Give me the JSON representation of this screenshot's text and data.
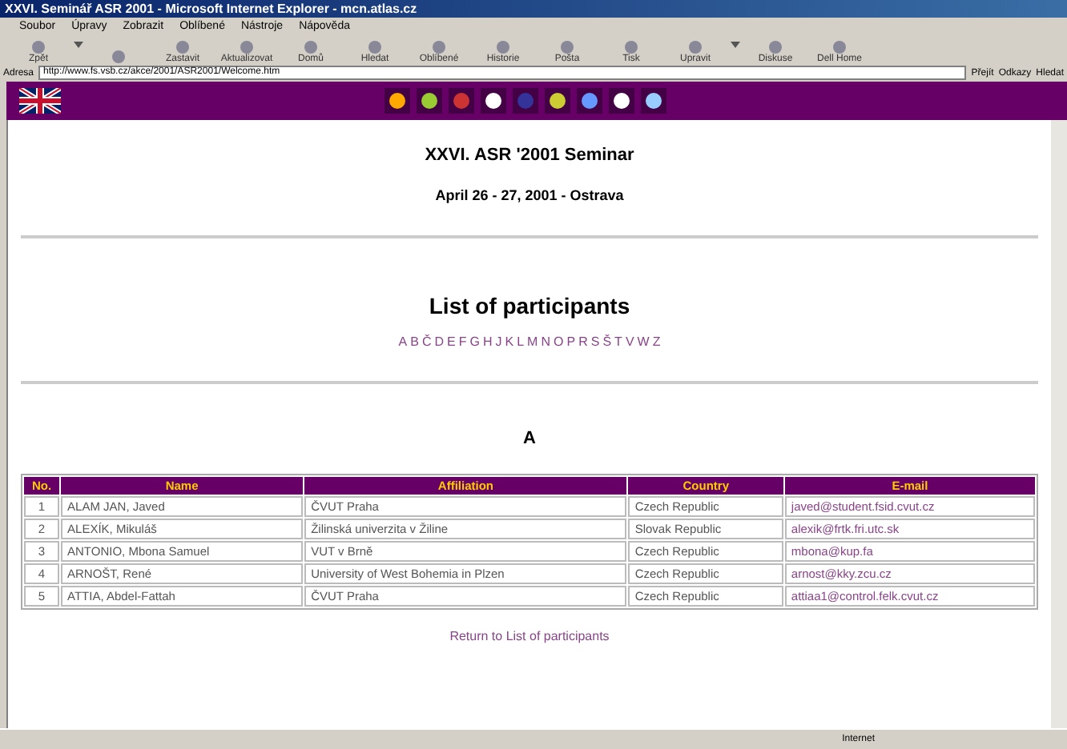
{
  "window": {
    "title": "XXVI. Seminář ASR 2001 - Microsoft Internet Explorer - mcn.atlas.cz"
  },
  "menu": [
    "Soubor",
    "Úpravy",
    "Zobrazit",
    "Oblíbené",
    "Nástroje",
    "Nápověda"
  ],
  "toolbar": [
    {
      "kind": "button",
      "label": "Zpět"
    },
    {
      "kind": "caret"
    },
    {
      "kind": "button"
    },
    {
      "kind": "button",
      "label": "Zastavit"
    },
    {
      "kind": "button",
      "label": "Aktualizovat"
    },
    {
      "kind": "button",
      "label": "Domů"
    },
    {
      "kind": "button",
      "label": "Hledat"
    },
    {
      "kind": "button",
      "label": "Oblíbené"
    },
    {
      "kind": "button",
      "label": "Historie"
    },
    {
      "kind": "button",
      "label": "Pošta"
    },
    {
      "kind": "button",
      "label": "Tisk"
    },
    {
      "kind": "button",
      "label": "Upravit"
    },
    {
      "kind": "caret"
    },
    {
      "kind": "button",
      "label": "Diskuse"
    },
    {
      "kind": "button",
      "label": "Dell Home"
    }
  ],
  "address": {
    "label": "Adresa",
    "url": "http://www.fs.vsb.cz/akce/2001/ASR2001/Welcome.htm",
    "go": "Přejít",
    "links": "Odkazy",
    "search": "Hledat"
  },
  "page": {
    "title": "XXVI. ASR '2001 Seminar",
    "date": "April 26 - 27, 2001 - Ostrava",
    "heading": "List of participants",
    "letters": [
      "A",
      "B",
      "Č",
      "D",
      "E",
      "F",
      "G",
      "H",
      "J",
      "K",
      "L",
      "M",
      "N",
      "O",
      "P",
      "R",
      "S",
      "Š",
      "T",
      "V",
      "W",
      "Z"
    ],
    "section": "A",
    "table": {
      "columns": [
        "No.",
        "Name",
        "Affiliation",
        "Country",
        "E-mail"
      ],
      "rows": [
        [
          "1",
          "ALAM JAN, Javed",
          "ČVUT Praha",
          "Czech Republic",
          "javed@student.fsid.cvut.cz"
        ],
        [
          "2",
          "ALEXÍK, Mikuláš",
          "Žilinská univerzita v Žiline",
          "Slovak Republic",
          "alexik@frtk.fri.utc.sk"
        ],
        [
          "3",
          "ANTONIO, Mbona Samuel",
          "VUT v Brně",
          "Czech Republic",
          "mbona@kup.fa"
        ],
        [
          "4",
          "ARNOŠT, René",
          "University of West Bohemia in Plzen",
          "Czech Republic",
          "arnost@kky.zcu.cz"
        ],
        [
          "5",
          "ATTIA, Abdel-Fattah",
          "ČVUT Praha",
          "Czech Republic",
          "attiaa1@control.felk.cvut.cz"
        ]
      ]
    },
    "return_link": "Return to List of participants"
  },
  "status": {
    "zone": "Internet"
  }
}
